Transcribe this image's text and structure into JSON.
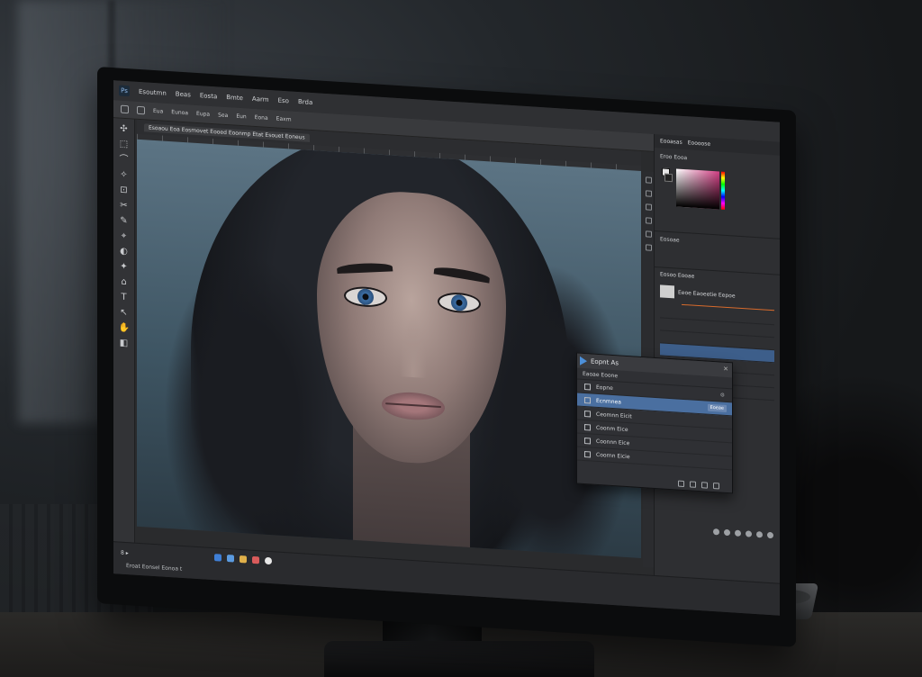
{
  "app": {
    "menu": [
      "Ps",
      "Esoutmn",
      "Beas",
      "Eosta",
      "Bmte",
      "Aarm",
      "Eso",
      "Brda"
    ],
    "options": [
      "Eua",
      "Eunoa",
      "Eupa",
      "Sea",
      "Eun",
      "Eona",
      "Eaxm"
    ],
    "tabs": [
      "Esoaou Eoa Eosmovet Eooed Eoonmp Etat Esouet Eoneus"
    ],
    "tools": [
      "✣",
      "⬚",
      "⌒",
      "✧",
      "⊡",
      "✂",
      "✎",
      "⌖",
      "◐",
      "✦",
      "⌂",
      "T",
      "↖",
      "✋",
      "◧"
    ]
  },
  "status": {
    "zoom": "8 ▸",
    "doc_info": "Eroat Eonsel Eonoa t"
  },
  "panels": {
    "tabs": [
      "Eooasas",
      "Eoooose"
    ],
    "color_label": "Eroo Eooa",
    "adjust_label": "Eosoae",
    "layer_title": "Eosoo Eooae",
    "layer_thumb_label": "Eeoe Eaoeetie Eepoe"
  },
  "dialog": {
    "title": "Eopnt As",
    "subtitle": "Eaoae Eoone",
    "items": [
      {
        "label": "Eopne",
        "icon": "file-icon"
      },
      {
        "label": "Ecnmnea",
        "icon": "folder-icon",
        "badge": "Eoeae"
      },
      {
        "label": "Ceomnn Eicit",
        "icon": "layer-icon"
      },
      {
        "label": "Coonm Eice",
        "icon": "layer-icon"
      },
      {
        "label": "Coonnn Eice",
        "icon": "layer-icon"
      },
      {
        "label": "Coornn Eicie",
        "icon": "layer-icon"
      }
    ]
  },
  "colors": {
    "accent": "#4c8fd8",
    "selection": "#4a6fa0",
    "layer_highlight": "#d86b2c"
  }
}
